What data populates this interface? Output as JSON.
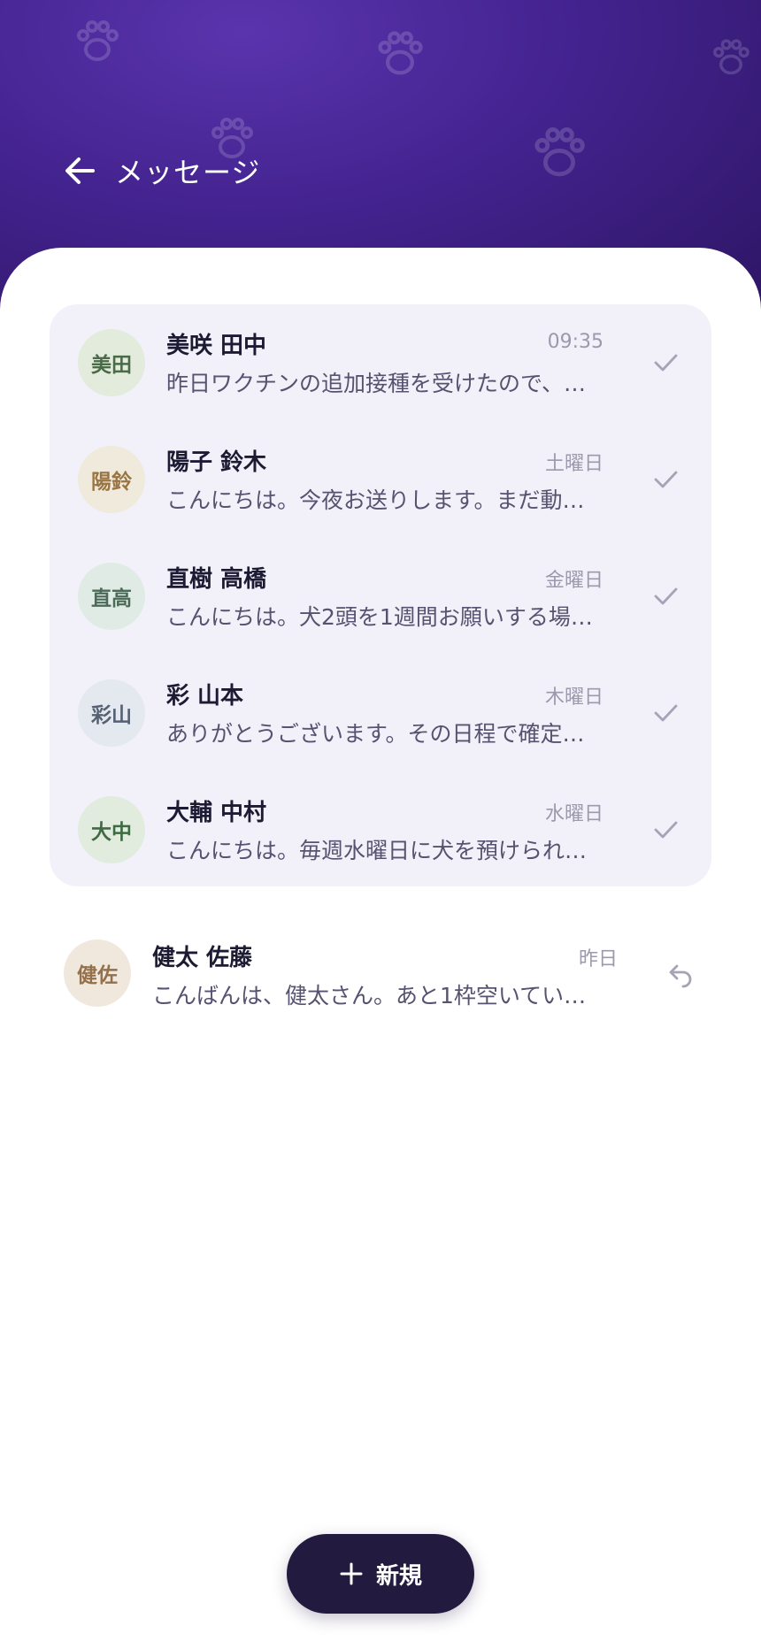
{
  "header": {
    "title": "メッセージ",
    "back_icon": "arrow-left-icon",
    "decoration_icon": "paw-print-icon"
  },
  "conversations": [
    {
      "initials": "美田",
      "name": "美咲 田中",
      "time": "09:35",
      "preview": "昨日ワクチンの追加接種を受けたので、…",
      "status_icon": "check-icon",
      "avatar_bg": "#e3ebdd",
      "avatar_fg": "#4a6a48"
    },
    {
      "initials": "陽鈴",
      "name": "陽子 鈴木",
      "time": "土曜日",
      "preview": "こんにちは。今夜お送りします。まだ動…",
      "status_icon": "check-icon",
      "avatar_bg": "#f0eadc",
      "avatar_fg": "#9a7442"
    },
    {
      "initials": "直高",
      "name": "直樹 高橋",
      "time": "金曜日",
      "preview": "こんにちは。犬2頭を1週間お願いする場…",
      "status_icon": "check-icon",
      "avatar_bg": "#e0ebe5",
      "avatar_fg": "#4b6a58"
    },
    {
      "initials": "彩山",
      "name": "彩 山本",
      "time": "木曜日",
      "preview": "ありがとうございます。その日程で確定…",
      "status_icon": "check-icon",
      "avatar_bg": "#e3e9ef",
      "avatar_fg": "#566073"
    },
    {
      "initials": "大中",
      "name": "大輔 中村",
      "time": "水曜日",
      "preview": "こんにちは。毎週水曜日に犬を預けられ…",
      "status_icon": "check-icon",
      "avatar_bg": "#e1ecdf",
      "avatar_fg": "#3f6a43"
    }
  ],
  "standalone": {
    "initials": "健佐",
    "name": "健太 佐藤",
    "time": "昨日",
    "preview": "こんばんは、健太さん。あと1枠空いてい…",
    "status_icon": "reply-icon",
    "avatar_bg": "#f0e8dc",
    "avatar_fg": "#94714a"
  },
  "fab": {
    "label": "新規",
    "icon": "plus-icon"
  },
  "colors": {
    "header_start": "#5a34ad",
    "header_end": "#2d1563",
    "group_bg": "#f2f1f9",
    "fab_bg": "#221a3f"
  }
}
